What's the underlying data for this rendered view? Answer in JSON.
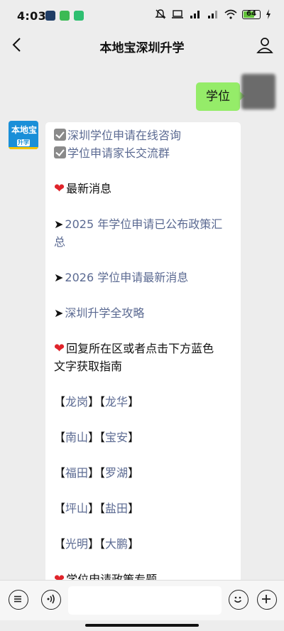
{
  "status_bar": {
    "time": "4:03",
    "battery": "64",
    "app_colors": [
      "#1f3d66",
      "#3cba54",
      "#2fbf71"
    ]
  },
  "nav": {
    "title": "本地宝深圳升学",
    "icons": [
      "chevron-left-icon",
      "person-icon"
    ]
  },
  "user_message": {
    "text": "学位"
  },
  "bot": {
    "avatar_text_top": "本地宝",
    "avatar_text_bottom": "升学",
    "lines": {
      "consult": "深圳学位申请在线咨询",
      "group": "学位申请家长交流群",
      "news_header": "最新消息",
      "policy_2025": "2025 年学位申请已公布政策汇总",
      "news_2026": "2026 学位申请最新消息",
      "guide": "深圳升学全攻略",
      "reply_prompt_1": "回复所在区或者点击下方蓝色",
      "reply_prompt_2": "文字获取指南",
      "policy_topic": "学位申请政策专题"
    },
    "districts": [
      [
        "龙岗",
        "龙华"
      ],
      [
        "南山",
        "宝安"
      ],
      [
        "福田",
        "罗湖"
      ],
      [
        "坪山",
        "盐田"
      ],
      [
        "光明",
        "大鹏"
      ]
    ]
  },
  "colors": {
    "link": "#5b6a92",
    "user_bubble": "#95ec69",
    "heart": "#e0242b"
  },
  "input_bar": {
    "icons": [
      "menu-icon",
      "voice-icon",
      "emoji-icon",
      "plus-icon"
    ]
  }
}
